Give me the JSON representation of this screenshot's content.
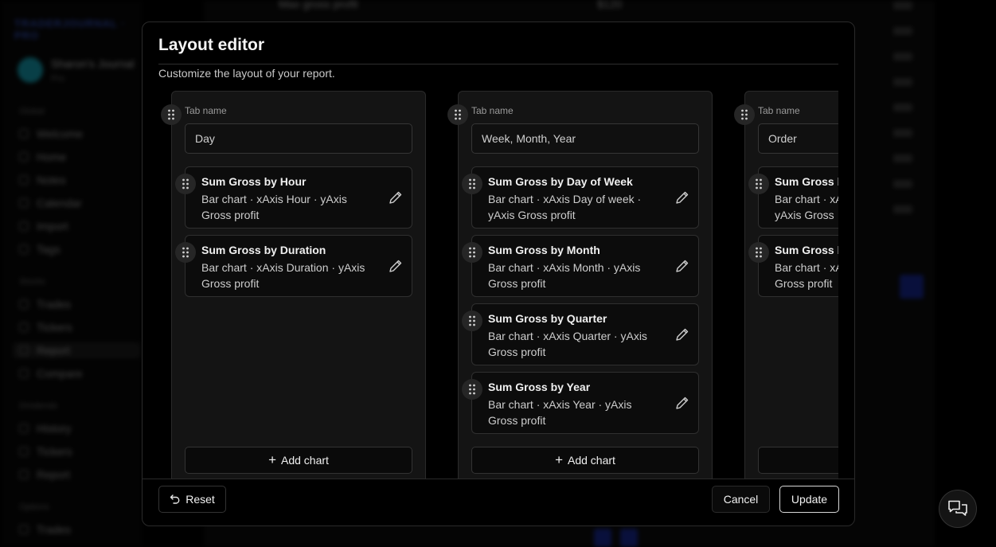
{
  "background": {
    "sidebar": {
      "brand": "TRADERJOURNAL · PRO",
      "account_name": "Sharon's Journal",
      "account_sub": "Pro",
      "sections": [
        {
          "label": "Global",
          "items": [
            "Welcome",
            "Home",
            "Notes",
            "Calendar",
            "Import",
            "Tags"
          ]
        },
        {
          "label": "Stocks",
          "items": [
            "Trades",
            "Tickers",
            "Report",
            "Compare"
          ]
        },
        {
          "label": "Dividends",
          "items": [
            "History",
            "Tickers",
            "Report"
          ]
        },
        {
          "label": "Options",
          "items": [
            "Trades"
          ]
        }
      ],
      "active_item": "Report"
    },
    "row_header": "Max gross profit",
    "row_value": "$120"
  },
  "modal": {
    "title": "Layout editor",
    "subtitle": "Customize the layout of your report.",
    "tab_name_label": "Tab name",
    "add_chart_label": "Add chart",
    "columns": [
      {
        "tab_name": "Day",
        "charts": [
          {
            "title": "Sum Gross by Hour",
            "desc": "Bar chart · xAxis Hour · yAxis Gross profit"
          },
          {
            "title": "Sum Gross by Duration",
            "desc": "Bar chart · xAxis Duration · yAxis Gross profit"
          }
        ]
      },
      {
        "tab_name": "Week, Month, Year",
        "charts": [
          {
            "title": "Sum Gross by Day of Week",
            "desc": "Bar chart · xAxis Day of week · yAxis Gross profit"
          },
          {
            "title": "Sum Gross by Month",
            "desc": "Bar chart · xAxis Month · yAxis Gross profit"
          },
          {
            "title": "Sum Gross by Quarter",
            "desc": "Bar chart · xAxis Quarter · yAxis Gross profit"
          },
          {
            "title": "Sum Gross by Year",
            "desc": "Bar chart · xAxis Year · yAxis Gross profit"
          }
        ]
      },
      {
        "tab_name": "Order",
        "charts": [
          {
            "title": "Sum Gross b",
            "desc": "Bar chart · xA yAxis Gross"
          },
          {
            "title": "Sum Gross b",
            "desc": "Bar chart · xA Gross profit"
          }
        ]
      }
    ],
    "footer": {
      "reset_label": "Reset",
      "cancel_label": "Cancel",
      "update_label": "Update"
    }
  },
  "icons": {
    "drag_handle": "drag-handle-icon",
    "edit": "pencil-icon",
    "add": "plus-icon",
    "reset": "undo-icon",
    "chat": "chat-icon"
  }
}
